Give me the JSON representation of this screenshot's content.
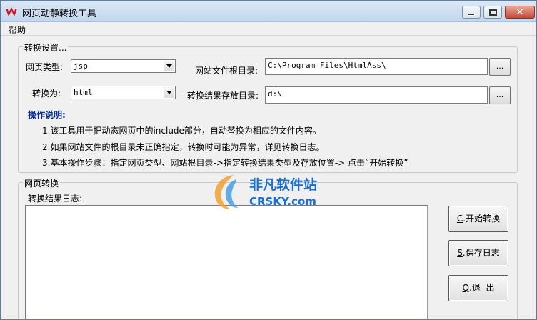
{
  "window": {
    "title": "网页动静转换工具",
    "close_glyph": "✕"
  },
  "menu": {
    "help": "帮助"
  },
  "settings": {
    "legend": "转换设置...",
    "page_type_label": "网页类型:",
    "page_type_value": "jsp",
    "convert_to_label": "转换为:",
    "convert_to_value": "html",
    "site_root_label": "网站文件根目录:",
    "site_root_value": "C:\\Program Files\\HtmlAss\\",
    "output_dir_label": "转换结果存放目录:",
    "output_dir_value": "d:\\",
    "browse_label": "...",
    "ops_title": "操作说明:",
    "ops": [
      "1.该工具用于把动态网页中的include部分，自动替换为相应的文件内容。",
      "2.如果网站文件的根目录未正确指定，转换时可能为异常，详见转换日志。",
      "3.基本操作步骤：指定网页类型、网站根目录->指定转换结果类型及存放位置-> 点击“开始转换”"
    ]
  },
  "convert": {
    "legend": "网页转换",
    "log_label": "转换结果日志:",
    "start": {
      "key": "C",
      "text": ".开始转换"
    },
    "save": {
      "key": "S",
      "text": ".保存日志"
    },
    "exit": {
      "key": "Q",
      "text": ".退  出"
    }
  },
  "watermark": {
    "line1": "非凡软件站",
    "line2": "CRSKY.com"
  },
  "colors": {
    "ops_title": "#0a2c9a",
    "watermark": "#1a6fd0",
    "close": "#c44a36"
  }
}
